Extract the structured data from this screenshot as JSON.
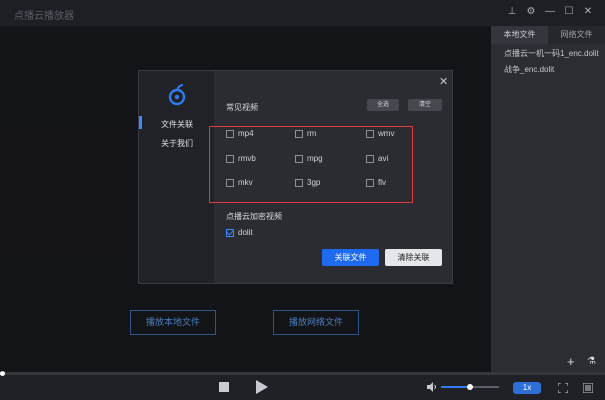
{
  "window": {
    "title": "点播云播放器",
    "pin_glyph": "⊥",
    "settings_glyph": "⚙",
    "minimize_glyph": "—",
    "maximize_glyph": "☐",
    "close_glyph": "✕"
  },
  "sidebar": {
    "tabs": [
      {
        "label": "本地文件",
        "active": true
      },
      {
        "label": "网络文件",
        "active": false
      }
    ],
    "files": [
      "点播云一机一码1_enc.dolit",
      "战争_enc.dolit"
    ],
    "add_glyph": "+",
    "clear_glyph": "⚗"
  },
  "main": {
    "play_local_label": "播放本地文件",
    "play_network_label": "播放网络文件"
  },
  "dialog": {
    "nav": [
      {
        "label": "文件关联",
        "active": true
      },
      {
        "label": "关于我们",
        "active": false
      }
    ],
    "close_glyph": "✕",
    "common_video_title": "常见视频",
    "select_all_label": "全选",
    "clear_label": "清空",
    "formats": [
      {
        "label": "mp4",
        "checked": false
      },
      {
        "label": "rm",
        "checked": false
      },
      {
        "label": "wmv",
        "checked": false
      },
      {
        "label": "rmvb",
        "checked": false
      },
      {
        "label": "mpg",
        "checked": false
      },
      {
        "label": "avi",
        "checked": false
      },
      {
        "label": "mkv",
        "checked": false
      },
      {
        "label": "3gp",
        "checked": false
      },
      {
        "label": "flv",
        "checked": false
      }
    ],
    "encrypted_title": "点播云加密视频",
    "encrypted_formats": [
      {
        "label": "dolit",
        "checked": true
      }
    ],
    "associate_label": "关联文件",
    "unassociate_label": "清除关联"
  },
  "controls": {
    "speed_label": "1x",
    "volume_fraction": 0.5,
    "progress_fraction": 0.0
  },
  "colors": {
    "accent": "#1f6bf0",
    "highlight_border": "#e23a3a",
    "sidebar_bg": "#2b2d33",
    "player_bg": "#18191d"
  }
}
